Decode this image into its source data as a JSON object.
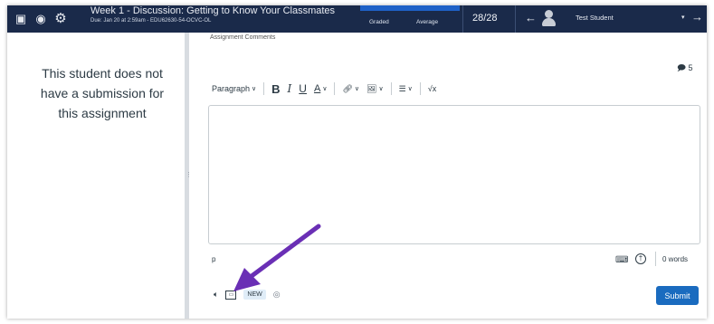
{
  "header": {
    "assignment_title": "Week 1 - Discussion: Getting to Know Your Classmates",
    "due_line": "Due: Jan 20 at 2:59am - EDU62630-54-OCVC-OL",
    "graded_label": "Graded",
    "average_label": "Average",
    "score": "28/28",
    "prev_arrow": "←",
    "student_name": "Test Student",
    "dropdown_caret": "▾",
    "next_arrow": "→"
  },
  "left_panel": {
    "no_submission_text": "This student does not have a submission for this assignment"
  },
  "comments": {
    "label": "Assignment Comments",
    "count": "5"
  },
  "editor": {
    "paragraph_label": "Paragraph",
    "bold": "B",
    "italic": "I",
    "underline": "U",
    "text_color": "A",
    "math": "√x",
    "status_path": "p",
    "word_count": "0 words"
  },
  "media": {
    "new_badge": "NEW"
  },
  "actions": {
    "submit_label": "Submit"
  },
  "colors": {
    "header_bg": "#1a2a4a",
    "submit_bg": "#1a6bbf",
    "arrow": "#6a2fb5"
  },
  "icons": [
    "speedgrader-icon",
    "eye-icon",
    "gear-icon",
    "comment-icon",
    "link-icon",
    "image-icon",
    "list-icon",
    "keyboard-icon",
    "accessibility-icon",
    "speaker-icon",
    "screen-capture-icon",
    "record-icon"
  ]
}
